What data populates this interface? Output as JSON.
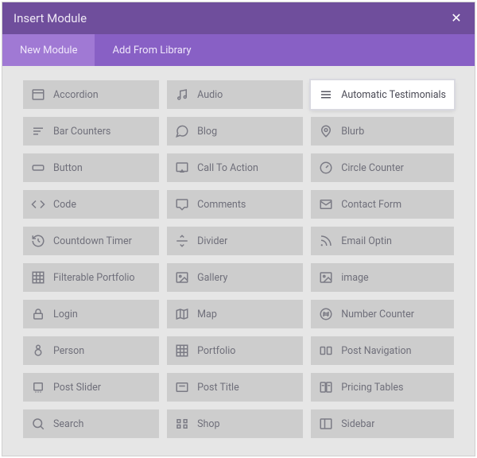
{
  "header": {
    "title": "Insert Module"
  },
  "tabs": {
    "new_module": "New Module",
    "add_from_library": "Add From Library"
  },
  "modules": [
    {
      "id": "accordion",
      "icon": "accordion-icon",
      "label": "Accordion",
      "highlight": false
    },
    {
      "id": "audio",
      "icon": "audio-icon",
      "label": "Audio",
      "highlight": false
    },
    {
      "id": "automatic-testimonials",
      "icon": "list-icon",
      "label": "Automatic Testimonials",
      "highlight": true
    },
    {
      "id": "bar-counters",
      "icon": "bars-icon",
      "label": "Bar Counters",
      "highlight": false
    },
    {
      "id": "blog",
      "icon": "comment-icon",
      "label": "Blog",
      "highlight": false
    },
    {
      "id": "blurb",
      "icon": "pin-outline-icon",
      "label": "Blurb",
      "highlight": false
    },
    {
      "id": "button",
      "icon": "button-icon",
      "label": "Button",
      "highlight": false
    },
    {
      "id": "call-to-action",
      "icon": "cta-icon",
      "label": "Call To Action",
      "highlight": false
    },
    {
      "id": "circle-counter",
      "icon": "gauge-icon",
      "label": "Circle Counter",
      "highlight": false
    },
    {
      "id": "code",
      "icon": "code-icon",
      "label": "Code",
      "highlight": false
    },
    {
      "id": "comments",
      "icon": "comment-fill-icon",
      "label": "Comments",
      "highlight": false
    },
    {
      "id": "contact-form",
      "icon": "mail-icon",
      "label": "Contact Form",
      "highlight": false
    },
    {
      "id": "countdown-timer",
      "icon": "history-icon",
      "label": "Countdown Timer",
      "highlight": false
    },
    {
      "id": "divider",
      "icon": "divider-icon",
      "label": "Divider",
      "highlight": false
    },
    {
      "id": "email-optin",
      "icon": "rss-icon",
      "label": "Email Optin",
      "highlight": false
    },
    {
      "id": "filterable-portfolio",
      "icon": "grid-icon",
      "label": "Filterable Portfolio",
      "highlight": false
    },
    {
      "id": "gallery",
      "icon": "image-icon",
      "label": "Gallery",
      "highlight": false
    },
    {
      "id": "image",
      "icon": "image-icon",
      "label": "image",
      "highlight": false
    },
    {
      "id": "login",
      "icon": "lock-icon",
      "label": "Login",
      "highlight": false
    },
    {
      "id": "map",
      "icon": "map-icon",
      "label": "Map",
      "highlight": false
    },
    {
      "id": "number-counter",
      "icon": "hash-icon",
      "label": "Number Counter",
      "highlight": false
    },
    {
      "id": "person",
      "icon": "person-icon",
      "label": "Person",
      "highlight": false
    },
    {
      "id": "portfolio",
      "icon": "grid-icon",
      "label": "Portfolio",
      "highlight": false
    },
    {
      "id": "post-navigation",
      "icon": "nav-icon",
      "label": "Post Navigation",
      "highlight": false
    },
    {
      "id": "post-slider",
      "icon": "slider-icon",
      "label": "Post Slider",
      "highlight": false
    },
    {
      "id": "post-title",
      "icon": "title-icon",
      "label": "Post Title",
      "highlight": false
    },
    {
      "id": "pricing-tables",
      "icon": "pricing-icon",
      "label": "Pricing Tables",
      "highlight": false
    },
    {
      "id": "search",
      "icon": "search-icon",
      "label": "Search",
      "highlight": false
    },
    {
      "id": "shop",
      "icon": "shop-icon",
      "label": "Shop",
      "highlight": false
    },
    {
      "id": "sidebar",
      "icon": "sidebar-icon",
      "label": "Sidebar",
      "highlight": false
    }
  ],
  "icons_svg": {
    "accordion-icon": "<svg width='18' height='18' viewBox='0 0 24 24' fill='none' stroke='currentColor' stroke-width='2'><rect x='3' y='4' width='18' height='16' rx='1'/><line x1='3' y1='9' x2='21' y2='9'/></svg>",
    "audio-icon": "<svg width='18' height='18' viewBox='0 0 24 24' fill='none' stroke='currentColor' stroke-width='2'><path d='M9 18V6l10-2v12'/><circle cx='7' cy='18' r='2'/><circle cx='17' cy='16' r='2'/></svg>",
    "list-icon": "<svg width='18' height='18' viewBox='0 0 24 24' fill='none' stroke='currentColor' stroke-width='2'><line x1='4' y1='7' x2='20' y2='7'/><line x1='4' y1='12' x2='20' y2='12'/><line x1='4' y1='17' x2='20' y2='17'/></svg>",
    "bars-icon": "<svg width='18' height='18' viewBox='0 0 24 24' fill='none' stroke='currentColor' stroke-width='2'><line x1='4' y1='7' x2='20' y2='7'/><line x1='4' y1='12' x2='16' y2='12'/><line x1='4' y1='17' x2='12' y2='17'/></svg>",
    "comment-icon": "<svg width='18' height='18' viewBox='0 0 24 24' fill='none' stroke='currentColor' stroke-width='2'><path d='M21 11.5a8.38 8.38 0 0 1-8.5 8.5 8.5 8.5 0 0 1-4-1L3 21l1.9-5.5A8.5 8.5 0 1 1 21 11.5z'/></svg>",
    "pin-outline-icon": "<svg width='18' height='18' viewBox='0 0 24 24' fill='none' stroke='currentColor' stroke-width='2'><path d='M12 21s-7-6-7-11a7 7 0 1 1 14 0c0 5-7 11-7 11z'/><circle cx='12' cy='10' r='2.5'/></svg>",
    "button-icon": "<svg width='18' height='18' viewBox='0 0 24 24' fill='none' stroke='currentColor' stroke-width='2'><rect x='3' y='8' width='18' height='8' rx='2'/></svg>",
    "cta-icon": "<svg width='18' height='18' viewBox='0 0 24 24' fill='none' stroke='currentColor' stroke-width='2'><rect x='3' y='4' width='18' height='14' rx='1'/><path d='M12 14l-4 6h8l-4-6z' fill='currentColor' stroke='none'/></svg>",
    "gauge-icon": "<svg width='18' height='18' viewBox='0 0 24 24' fill='none' stroke='currentColor' stroke-width='2'><circle cx='12' cy='12' r='9'/><path d='M12 12l4-4'/></svg>",
    "code-icon": "<svg width='18' height='18' viewBox='0 0 24 24' fill='none' stroke='currentColor' stroke-width='2'><polyline points='16 18 22 12 16 6'/><polyline points='8 6 2 12 8 18'/></svg>",
    "comment-fill-icon": "<svg width='18' height='18' viewBox='0 0 24 24' fill='none' stroke='currentColor' stroke-width='2'><path d='M20 4H4a1 1 0 0 0-1 1v11a1 1 0 0 0 1 1h4l4 4 4-4h4a1 1 0 0 0 1-1V5a1 1 0 0 0-1-1z'/></svg>",
    "mail-icon": "<svg width='18' height='18' viewBox='0 0 24 24' fill='none' stroke='currentColor' stroke-width='2'><rect x='3' y='5' width='18' height='14' rx='1'/><polyline points='3 7 12 13 21 7'/></svg>",
    "history-icon": "<svg width='18' height='18' viewBox='0 0 24 24' fill='none' stroke='currentColor' stroke-width='2'><path d='M3 12a9 9 0 1 0 3-6.7L3 8'/><polyline points='3 3 3 8 8 8'/><line x1='12' y1='8' x2='12' y2='12'/><line x1='12' y1='12' x2='15' y2='14'/></svg>",
    "divider-icon": "<svg width='18' height='18' viewBox='0 0 24 24' fill='none' stroke='currentColor' stroke-width='2'><line x1='3' y1='12' x2='21' y2='12'/><polyline points='9 6 12 3 15 6'/><polyline points='9 18 12 21 15 18'/></svg>",
    "rss-icon": "<svg width='18' height='18' viewBox='0 0 24 24' fill='none' stroke='currentColor' stroke-width='2'><path d='M4 11a9 9 0 0 1 9 9'/><path d='M4 4a16 16 0 0 1 16 16'/><circle cx='5' cy='19' r='1.5' fill='currentColor' stroke='none'/></svg>",
    "grid-icon": "<svg width='18' height='18' viewBox='0 0 24 24' fill='none' stroke='currentColor' stroke-width='2'><rect x='3' y='3' width='18' height='18'/><line x1='9' y1='3' x2='9' y2='21'/><line x1='15' y1='3' x2='15' y2='21'/><line x1='3' y1='9' x2='21' y2='9'/><line x1='3' y1='15' x2='21' y2='15'/></svg>",
    "image-icon": "<svg width='18' height='18' viewBox='0 0 24 24' fill='none' stroke='currentColor' stroke-width='2'><rect x='3' y='4' width='18' height='16' rx='1'/><circle cx='9' cy='10' r='1.5'/><path d='M21 17l-5-5-8 8'/></svg>",
    "lock-icon": "<svg width='18' height='18' viewBox='0 0 24 24' fill='none' stroke='currentColor' stroke-width='2'><rect x='5' y='11' width='14' height='9' rx='1.5'/><path d='M8 11V8a4 4 0 0 1 8 0v3'/></svg>",
    "map-icon": "<svg width='18' height='18' viewBox='0 0 24 24' fill='none' stroke='currentColor' stroke-width='2'><polygon points='3 6 9 4 15 6 21 4 21 18 15 20 9 18 3 20 3 6'/><line x1='9' y1='4' x2='9' y2='18'/><line x1='15' y1='6' x2='15' y2='20'/></svg>",
    "hash-icon": "<svg width='18' height='18' viewBox='0 0 24 24' fill='none' stroke='currentColor' stroke-width='2'><circle cx='12' cy='12' r='9'/><line x1='9' y1='8' x2='8' y2='16'/><line x1='16' y1='8' x2='15' y2='16'/><line x1='7' y1='10.5' x2='17' y2='10.5'/><line x1='7' y1='13.5' x2='17' y2='13.5'/></svg>",
    "person-icon": "<svg width='18' height='18' viewBox='0 0 24 24' fill='none' stroke='currentColor' stroke-width='2'><circle cx='12' cy='6' r='3'/><circle cx='12' cy='15' r='5'/></svg>",
    "nav-icon": "<svg width='18' height='18' viewBox='0 0 24 24' fill='none' stroke='currentColor' stroke-width='2'><rect x='3' y='6' width='7' height='12' rx='1'/><rect x='14' y='6' width='7' height='12' rx='1'/></svg>",
    "slider-icon": "<svg width='18' height='18' viewBox='0 0 24 24' fill='none' stroke='currentColor' stroke-width='2'><rect x='5' y='5' width='14' height='12' rx='1'/><circle cx='8' cy='20' r='1' fill='currentColor' stroke='none'/><circle cx='12' cy='20' r='1' fill='currentColor' stroke='none'/><circle cx='16' cy='20' r='1' fill='currentColor' stroke='none'/></svg>",
    "title-icon": "<svg width='18' height='18' viewBox='0 0 24 24' fill='none' stroke='currentColor' stroke-width='2'><rect x='3' y='5' width='18' height='14' rx='1'/><line x1='7' y1='10' x2='17' y2='10'/></svg>",
    "pricing-icon": "<svg width='18' height='18' viewBox='0 0 24 24' fill='none' stroke='currentColor' stroke-width='2'><rect x='3' y='4' width='8' height='16' rx='1'/><rect x='13' y='4' width='8' height='16' rx='1'/><line x1='5' y1='9' x2='9' y2='9'/><line x1='15' y1='9' x2='19' y2='9'/></svg>",
    "search-icon": "<svg width='18' height='18' viewBox='0 0 24 24' fill='none' stroke='currentColor' stroke-width='2'><circle cx='11' cy='11' r='7'/><line x1='21' y1='21' x2='16' y2='16'/></svg>",
    "shop-icon": "<svg width='18' height='18' viewBox='0 0 24 24' fill='none' stroke='currentColor' stroke-width='2'><rect x='4' y='5' width='5' height='5'/><rect x='15' y='5' width='5' height='5'/><rect x='4' y='14' width='5' height='5'/><rect x='15' y='14' width='5' height='5'/></svg>",
    "sidebar-icon": "<svg width='18' height='18' viewBox='0 0 24 24' fill='none' stroke='currentColor' stroke-width='2'><rect x='3' y='4' width='18' height='16' rx='1'/><line x1='10' y1='4' x2='10' y2='20'/></svg>"
  }
}
